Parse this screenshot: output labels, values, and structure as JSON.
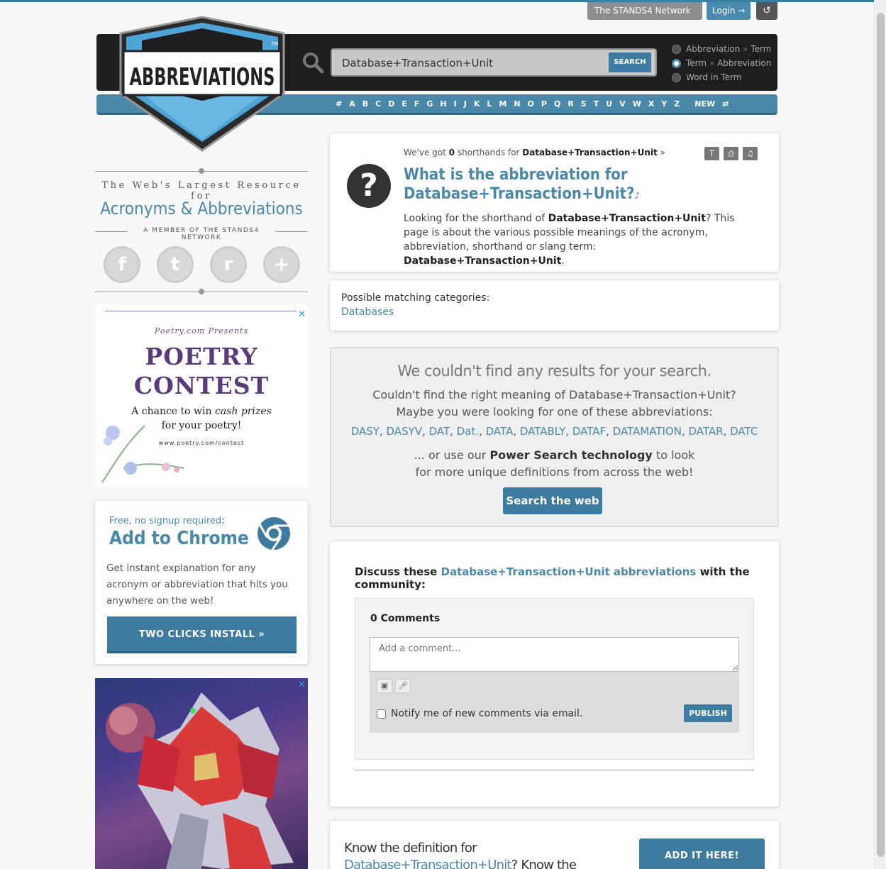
{
  "network": {
    "network_label": "The STANDS4 Network",
    "login_label": "Login",
    "history_icon": "history-icon"
  },
  "search": {
    "query": "Database+Transaction+Unit",
    "button_label": "SEARCH",
    "modes": [
      {
        "label_a": "Abbreviation",
        "label_b": "Term",
        "selected": false
      },
      {
        "label_a": "Term",
        "label_b": "Abbreviation",
        "selected": true
      },
      {
        "label_a": "Word in Term",
        "label_b": "",
        "selected": false
      }
    ]
  },
  "letters": [
    "#",
    "A",
    "B",
    "C",
    "D",
    "E",
    "F",
    "G",
    "H",
    "I",
    "J",
    "K",
    "L",
    "M",
    "N",
    "O",
    "P",
    "Q",
    "R",
    "S",
    "T",
    "U",
    "V",
    "W",
    "X",
    "Y",
    "Z"
  ],
  "letters_extra": {
    "new_label": "NEW",
    "random_icon": "shuffle-icon"
  },
  "logo": {
    "text": "ABBREVIATIONS",
    "tm": "TM"
  },
  "sidebar": {
    "tagline_1": "The Web's Largest Resource for",
    "tagline_2": "Acronyms & Abbreviations",
    "tagline_3": "A MEMBER OF THE STANDS4 NETWORK",
    "social": [
      {
        "name": "facebook-icon",
        "glyph": "f"
      },
      {
        "name": "twitter-icon",
        "glyph": "t"
      },
      {
        "name": "reddit-icon",
        "glyph": "r"
      },
      {
        "name": "more-icon",
        "glyph": "+"
      }
    ]
  },
  "ad_poetry": {
    "presents": "Poetry.com Presents",
    "title_1": "POETRY",
    "title_2": "CONTEST",
    "sub_1": "A chance to win",
    "sub_em": "cash prizes",
    "sub_2": "for your poetry!",
    "url": "www.poetry.com/contest",
    "close": "✕"
  },
  "chrome": {
    "free_label": "Free, no signup required",
    "free_colon": ":",
    "title": "Add to Chrome",
    "description": "Get instant explanation for any acronym or abbreviation that hits you anywhere on the web!",
    "button": "TWO CLICKS INSTALL »"
  },
  "ad_gundam": {
    "close": "✕"
  },
  "result": {
    "count_prefix": "We've got",
    "count": "0",
    "count_mid": "shorthands for",
    "term": "Database+Transaction+Unit",
    "count_suffix": "»",
    "question_1": "What is the abbreviation for",
    "question_2": "Database+Transaction+Unit?",
    "intro_1": "Looking for the shorthand of",
    "intro_term": "Database+Transaction+Unit",
    "intro_2": "? This page is about the various possible meanings of the acronym, abbreviation, shorthand or slang term:",
    "intro_end": ".",
    "tools": [
      "font-size-icon",
      "print-icon",
      "audio-icon"
    ]
  },
  "categories": {
    "label": "Possible matching categories:",
    "items": [
      "Databases"
    ]
  },
  "no_results": {
    "title": "We couldn't find any results for your search.",
    "line_1": "Couldn't find the right meaning of Database+Transaction+Unit?",
    "line_2": "Maybe you were looking for one of these abbreviations:",
    "suggestions": [
      "DASY",
      "DASYV",
      "DAT",
      "Dat.",
      "DATA",
      "DATABLY",
      "DATAF",
      "DATAMATION",
      "DATAR",
      "DATC"
    ],
    "power_1": "... or use our",
    "power_bold": "Power Search technology",
    "power_2": "to look",
    "power_3": "for more unique definitions from across the web!",
    "button": "Search the web"
  },
  "discuss": {
    "prefix": "Discuss these",
    "link": "Database+Transaction+Unit abbreviations",
    "suffix": "with the community:",
    "comments_count": "0 Comments",
    "placeholder": "Add a comment...",
    "notify": "Notify me of new comments via email.",
    "publish": "PUBLISH"
  },
  "know": {
    "prefix": "Know the definition for",
    "link": "Database+Transaction+Unit",
    "suffix": "? Know the meaning",
    "button": "ADD IT HERE!"
  }
}
